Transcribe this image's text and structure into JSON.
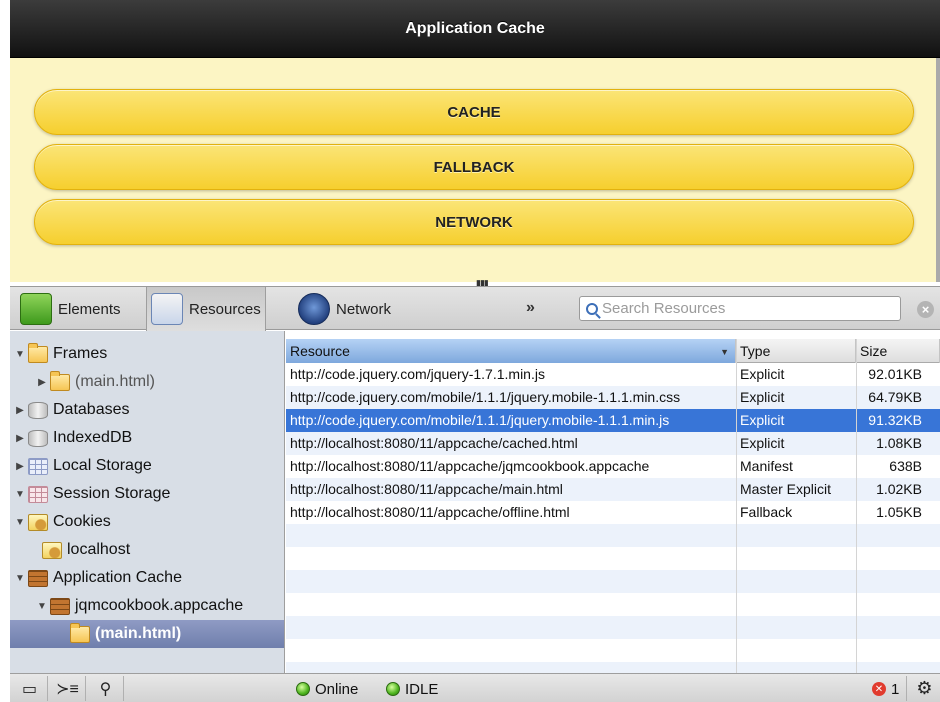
{
  "app_header": {
    "title": "Application Cache"
  },
  "page_buttons": [
    {
      "label": "CACHE"
    },
    {
      "label": "FALLBACK"
    },
    {
      "label": "NETWORK"
    }
  ],
  "toolbar": {
    "tabs": [
      {
        "label": "Elements",
        "icon": "elements-icon",
        "selected": false
      },
      {
        "label": "Resources",
        "icon": "resources-icon",
        "selected": true
      },
      {
        "label": "Network",
        "icon": "network-icon",
        "selected": false
      }
    ],
    "overflow_label": "»",
    "search_placeholder": "Search Resources"
  },
  "sidebar": {
    "items": [
      {
        "label": "Frames",
        "icon": "folder-icon",
        "disclosure": "▼"
      },
      {
        "label": "(main.html)",
        "icon": "folder-icon",
        "disclosure": "▶"
      },
      {
        "label": "Databases",
        "icon": "database-icon",
        "disclosure": "▶"
      },
      {
        "label": "IndexedDB",
        "icon": "database-icon",
        "disclosure": "▶"
      },
      {
        "label": "Local Storage",
        "icon": "local-storage-icon",
        "disclosure": "▶"
      },
      {
        "label": "Session Storage",
        "icon": "session-storage-icon",
        "disclosure": "▼"
      },
      {
        "label": "Cookies",
        "icon": "cookies-icon",
        "disclosure": "▼"
      },
      {
        "label": "localhost",
        "icon": "cookie-icon",
        "disclosure": ""
      },
      {
        "label": "Application Cache",
        "icon": "application-cache-icon",
        "disclosure": "▼"
      },
      {
        "label": "jqmcookbook.appcache",
        "icon": "appcache-manifest-icon",
        "disclosure": "▼"
      },
      {
        "label": "(main.html)",
        "icon": "folder-icon",
        "disclosure": ""
      }
    ]
  },
  "grid": {
    "columns": {
      "resource": "Resource",
      "type": "Type",
      "size": "Size"
    },
    "rows": [
      {
        "resource": "http://code.jquery.com/jquery-1.7.1.min.js",
        "type": "Explicit",
        "size": "92.01KB"
      },
      {
        "resource": "http://code.jquery.com/mobile/1.1.1/jquery.mobile-1.1.1.min.css",
        "type": "Explicit",
        "size": "64.79KB"
      },
      {
        "resource": "http://code.jquery.com/mobile/1.1.1/jquery.mobile-1.1.1.min.js",
        "type": "Explicit",
        "size": "91.32KB"
      },
      {
        "resource": "http://localhost:8080/11/appcache/cached.html",
        "type": "Explicit",
        "size": "1.08KB"
      },
      {
        "resource": "http://localhost:8080/11/appcache/jqmcookbook.appcache",
        "type": "Manifest",
        "size": "638B"
      },
      {
        "resource": "http://localhost:8080/11/appcache/main.html",
        "type": "Master Explicit",
        "size": "1.02KB"
      },
      {
        "resource": "http://localhost:8080/11/appcache/offline.html",
        "type": "Fallback",
        "size": "1.05KB"
      }
    ]
  },
  "statusbar": {
    "online_label": "Online",
    "idle_label": "IDLE",
    "error_count": "1",
    "error_symbol": "✕"
  }
}
